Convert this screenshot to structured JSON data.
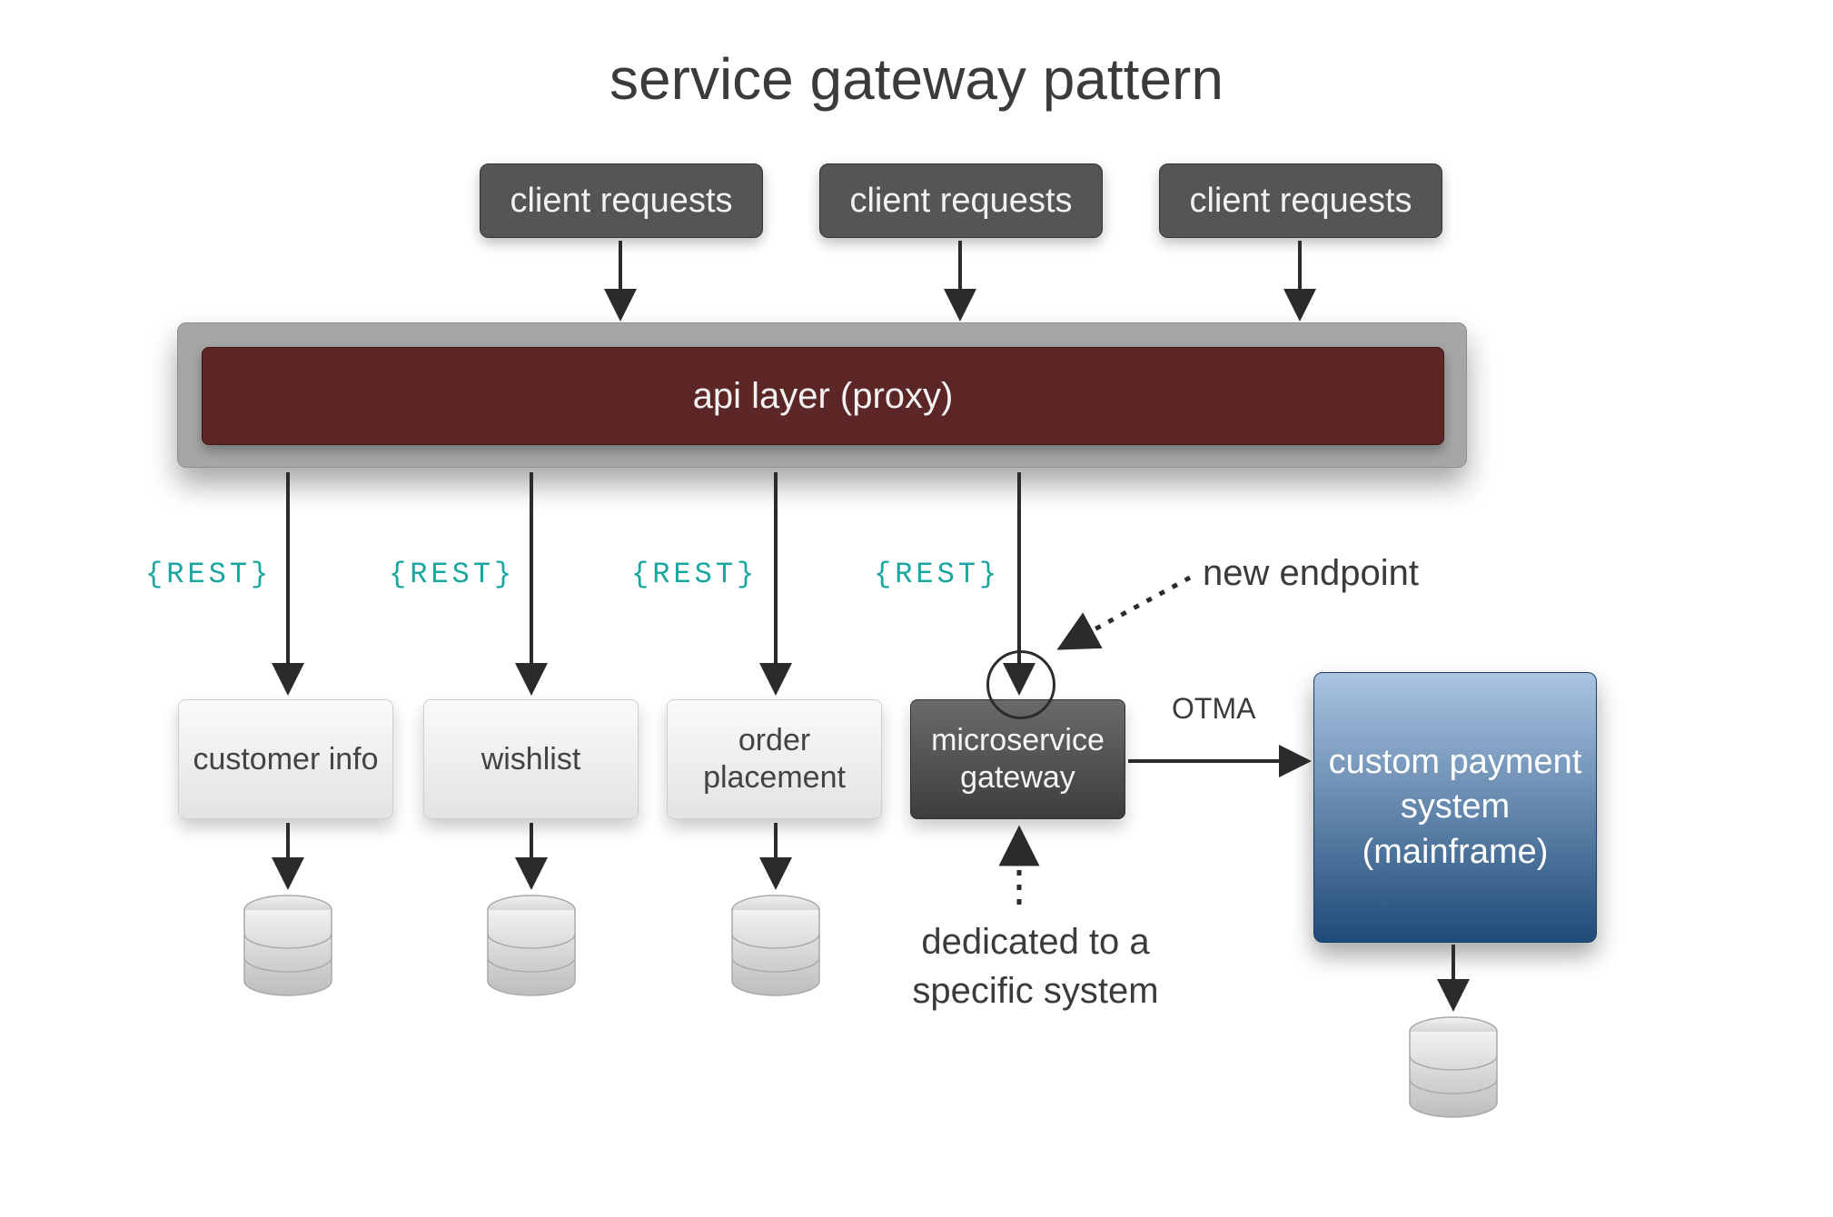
{
  "title": "service gateway pattern",
  "clients": [
    "client requests",
    "client requests",
    "client requests"
  ],
  "api_layer": "api layer (proxy)",
  "rest_label": "{REST}",
  "services": {
    "customer": "customer info",
    "wishlist": "wishlist",
    "order": "order placement",
    "gateway": "microservice gateway"
  },
  "mainframe": "custom payment system (mainframe)",
  "otma": "OTMA",
  "annotations": {
    "new_endpoint": "new endpoint",
    "dedicated": "dedicated to a specific system"
  }
}
